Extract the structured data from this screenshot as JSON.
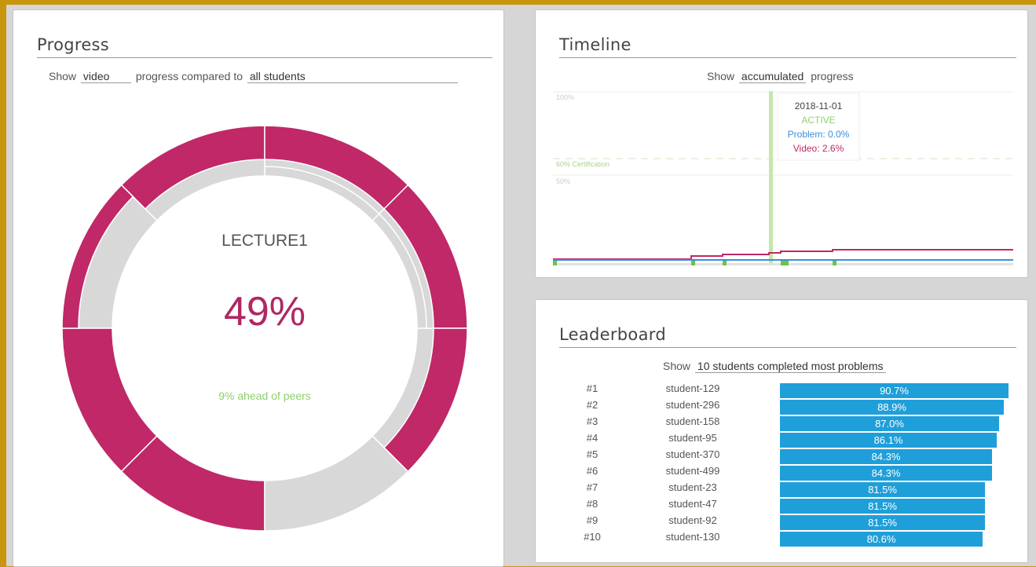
{
  "progress": {
    "title": "Progress",
    "show_label": "Show",
    "metric": "video",
    "middle_label": "progress compared to",
    "compare_to": "all students",
    "lecture": "LECTURE1",
    "percent": "49%",
    "peer_text": "9% ahead of peers",
    "colors": {
      "accent": "#c02868",
      "track": "#d8d8d8",
      "peer": "#8ed16b"
    }
  },
  "timeline": {
    "title": "Timeline",
    "show_label": "Show",
    "mode": "accumulated",
    "suffix": "progress",
    "axis_100": "100%",
    "axis_50": "50%",
    "cert_label": "60% Certification",
    "tooltip": {
      "date": "2018-11-01",
      "status": "ACTIVE",
      "problem": "Problem: 0.0%",
      "video": "Video: 2.6%"
    },
    "colors": {
      "video": "#c02868",
      "problem": "#3a8fd8",
      "active": "#8ed16b"
    }
  },
  "leaderboard": {
    "title": "Leaderboard",
    "show_label": "Show",
    "selector": "10 students completed most problems",
    "rows": [
      {
        "rank": "#1",
        "name": "student-129",
        "value": 90.7,
        "label": "90.7%"
      },
      {
        "rank": "#2",
        "name": "student-296",
        "value": 88.9,
        "label": "88.9%"
      },
      {
        "rank": "#3",
        "name": "student-158",
        "value": 87.0,
        "label": "87.0%"
      },
      {
        "rank": "#4",
        "name": "student-95",
        "value": 86.1,
        "label": "86.1%"
      },
      {
        "rank": "#5",
        "name": "student-370",
        "value": 84.3,
        "label": "84.3%"
      },
      {
        "rank": "#6",
        "name": "student-499",
        "value": 84.3,
        "label": "84.3%"
      },
      {
        "rank": "#7",
        "name": "student-23",
        "value": 81.5,
        "label": "81.5%"
      },
      {
        "rank": "#8",
        "name": "student-47",
        "value": 81.5,
        "label": "81.5%"
      },
      {
        "rank": "#9",
        "name": "student-92",
        "value": 81.5,
        "label": "81.5%"
      },
      {
        "rank": "#10",
        "name": "student-130",
        "value": 80.6,
        "label": "80.6%"
      }
    ],
    "bar_color": "#1f9fd9"
  }
}
